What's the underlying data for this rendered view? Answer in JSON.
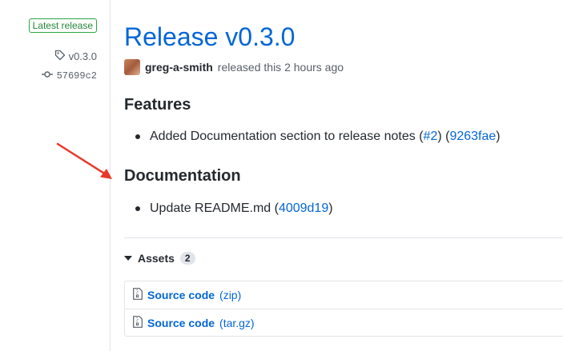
{
  "sidebar": {
    "latest_badge": "Latest release",
    "tag": "v0.3.0",
    "commit": "57699c2"
  },
  "release": {
    "title": "Release v0.3.0",
    "author": "greg-a-smith",
    "released_text": "released this 2 hours ago"
  },
  "sections": {
    "features": {
      "heading": "Features",
      "item": {
        "text": "Added Documentation section to release notes (",
        "pr_link": "#2",
        "mid": ") (",
        "commit_link": "9263fae",
        "end": ")"
      }
    },
    "documentation": {
      "heading": "Documentation",
      "item": {
        "text": "Update README.md (",
        "commit_link": "4009d19",
        "end": ")"
      }
    }
  },
  "assets": {
    "label": "Assets",
    "count": "2",
    "items": [
      {
        "name": "Source code",
        "ext": "(zip)"
      },
      {
        "name": "Source code",
        "ext": "(tar.gz)"
      }
    ]
  },
  "colors": {
    "link": "#0366d6",
    "badge_green": "#28a745",
    "annotation_arrow": "#e8392a"
  },
  "icons": {
    "tag": "tag-icon",
    "commit": "git-commit-icon",
    "zip": "file-zip-icon",
    "caret": "caret-down-icon",
    "arrow": "annotation-arrow"
  }
}
